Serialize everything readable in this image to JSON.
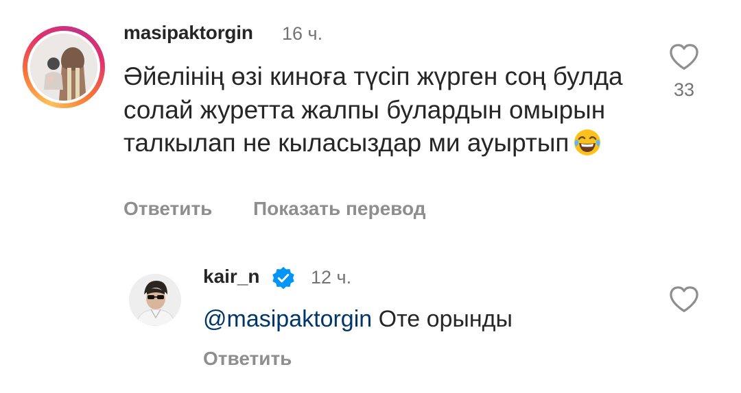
{
  "comments": [
    {
      "username": "masipaktorgin",
      "time": "16 ч.",
      "text": "Әйелінің өзі киноға түсіп жүрген соң булда солай журетта жалпы булардын омырын талкылап не кыласыздар ми ауыртып",
      "emoji": "face-with-tears-of-joy",
      "reply_label": "Ответить",
      "translate_label": "Показать перевод",
      "like_count": "33",
      "avatar_ring": "story-gradient"
    },
    {
      "username": "kair_n",
      "verified": true,
      "time": "12 ч.",
      "mention": "@masipaktorgin",
      "text": "Оте орынды",
      "reply_label": "Ответить"
    }
  ],
  "icons": {
    "like": "heart-outline-icon",
    "verified": "verified-badge-icon"
  },
  "colors": {
    "primary_text": "#262626",
    "secondary_text": "#737373",
    "action_text": "#8e8e8e",
    "mention": "#00376b",
    "verified_badge": "#0095f6"
  }
}
